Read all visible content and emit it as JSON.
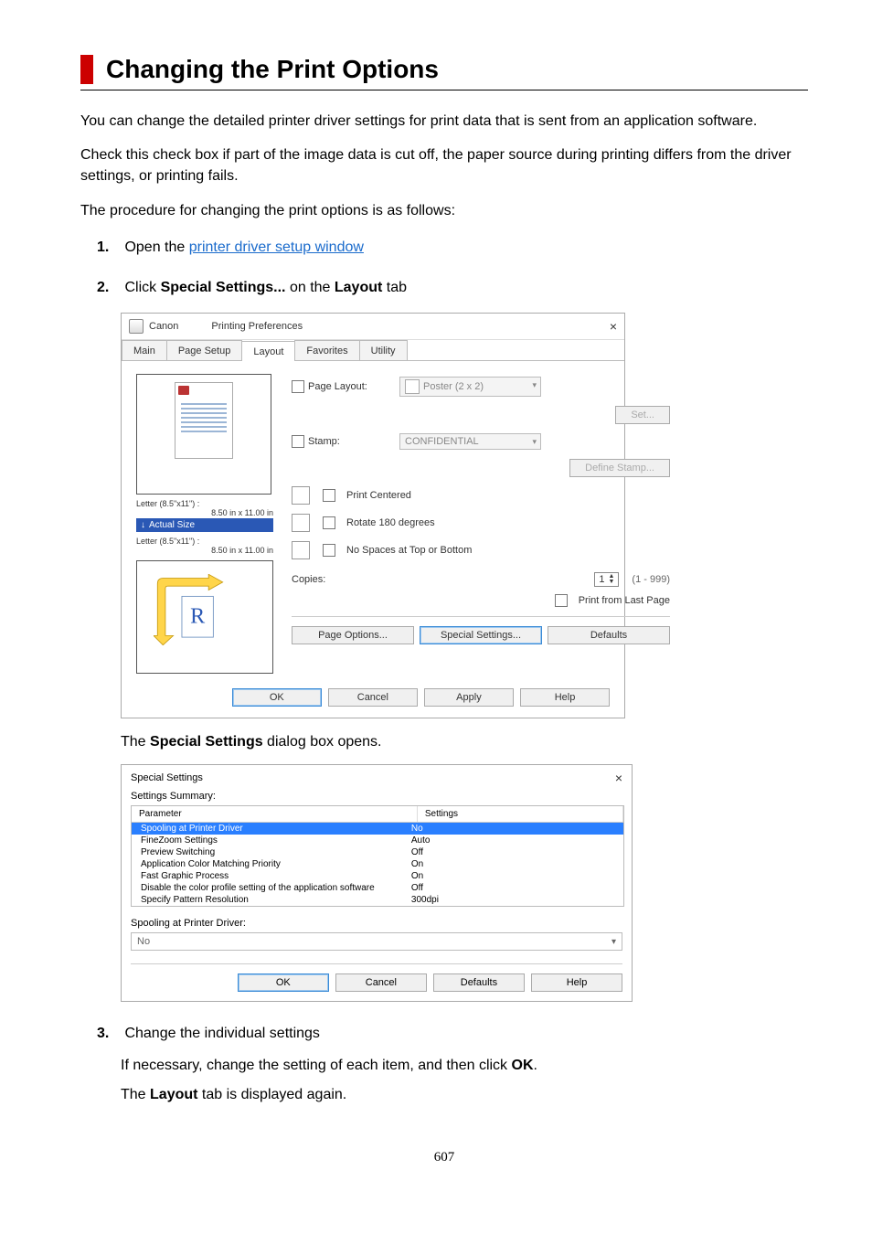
{
  "title": "Changing the Print Options",
  "p1": "You can change the detailed printer driver settings for print data that is sent from an application software.",
  "p2": "Check this check box if part of the image data is cut off, the paper source during printing differs from the driver settings, or printing fails.",
  "p3": "The procedure for changing the print options is as follows:",
  "steps": {
    "s1_prefix": "Open the ",
    "s1_link": "printer driver setup window",
    "s2_a": "Click ",
    "s2_b": "Special Settings...",
    "s2_c": " on the ",
    "s2_d": "Layout",
    "s2_e": " tab",
    "s2_sub1_a": "The ",
    "s2_sub1_b": "Special Settings",
    "s2_sub1_c": " dialog box opens.",
    "s3_head": "Change the individual settings",
    "s3_p1_a": "If necessary, change the setting of each item, and then click ",
    "s3_p1_b": "OK",
    "s3_p1_c": ".",
    "s3_p2_a": "The ",
    "s3_p2_b": "Layout",
    "s3_p2_c": " tab is displayed again."
  },
  "page_num": "607",
  "dlg1": {
    "title_prefix": "Canon",
    "title_suffix": "Printing Preferences",
    "tabs": [
      "Main",
      "Page Setup",
      "Layout",
      "Favorites",
      "Utility"
    ],
    "active_tab": 2,
    "size1": {
      "name": "Letter (8.5\"x11\") :",
      "dim": "8.50 in x 11.00 in"
    },
    "actual": "Actual Size",
    "size2": {
      "name": "Letter (8.5\"x11\") :",
      "dim": "8.50 in x 11.00 in"
    },
    "page_layout_lbl": "Page Layout:",
    "page_layout_val": "Poster (2 x 2)",
    "set_btn": "Set...",
    "stamp_lbl": "Stamp:",
    "stamp_val": "CONFIDENTIAL",
    "define_stamp": "Define Stamp...",
    "print_centered": "Print Centered",
    "rotate_180": "Rotate 180 degrees",
    "no_spaces": "No Spaces at Top or Bottom",
    "copies_lbl": "Copies:",
    "copies_val": "1",
    "copies_range": "(1 - 999)",
    "print_last": "Print from Last Page",
    "page_options": "Page Options...",
    "special_settings": "Special Settings...",
    "defaults": "Defaults",
    "ok": "OK",
    "cancel": "Cancel",
    "apply": "Apply",
    "help": "Help"
  },
  "dlg2": {
    "title": "Special Settings",
    "summary_lbl": "Settings Summary:",
    "col_param": "Parameter",
    "col_set": "Settings",
    "rows": [
      {
        "p": "Spooling at Printer Driver",
        "s": "No",
        "sel": true
      },
      {
        "p": "FineZoom Settings",
        "s": "Auto"
      },
      {
        "p": "Preview Switching",
        "s": "Off"
      },
      {
        "p": "Application Color Matching Priority",
        "s": "On"
      },
      {
        "p": "Fast Graphic Process",
        "s": "On"
      },
      {
        "p": "Disable the color profile setting of the application software",
        "s": "Off"
      },
      {
        "p": "Specify Pattern Resolution",
        "s": "300dpi"
      }
    ],
    "spool_lbl": "Spooling at Printer Driver:",
    "spool_val": "No",
    "ok": "OK",
    "cancel": "Cancel",
    "defaults": "Defaults",
    "help": "Help"
  }
}
